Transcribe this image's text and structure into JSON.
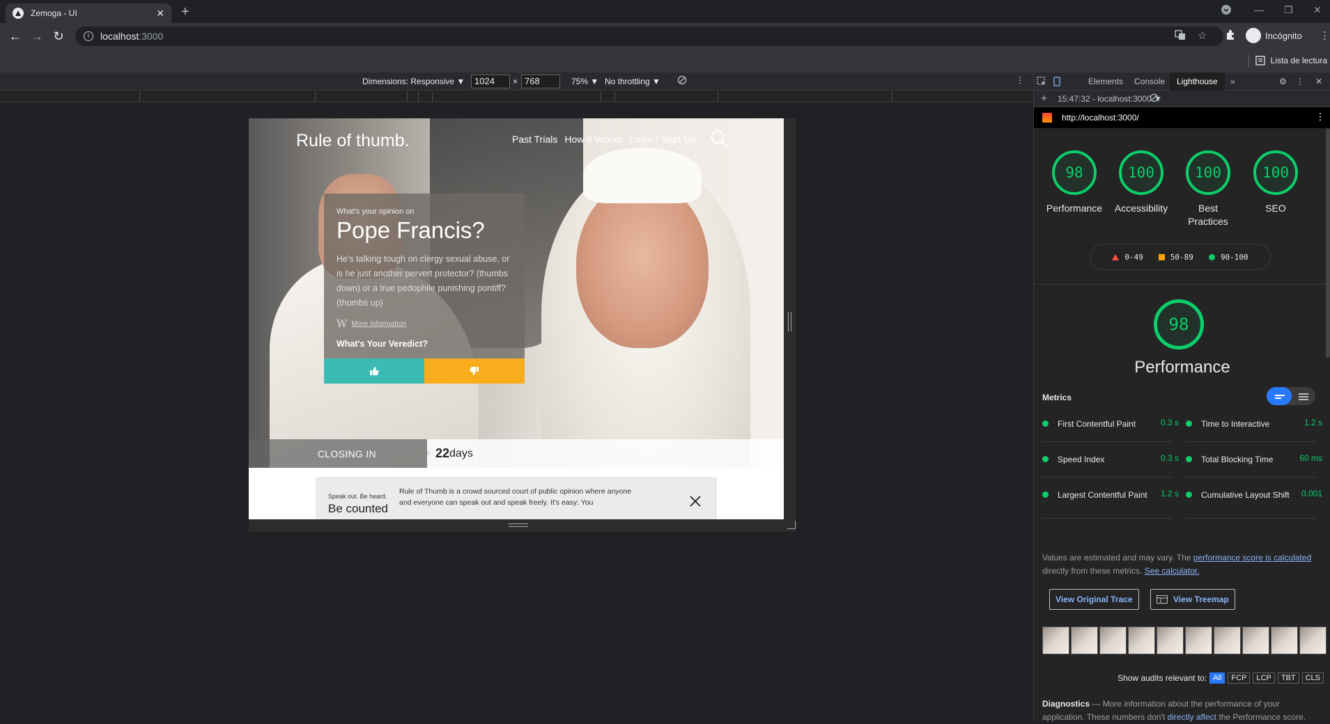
{
  "browser": {
    "tab_title": "Zemoga - UI",
    "url_host": "localhost",
    "url_port": ":3000",
    "profile_label": "Incógnito",
    "reading_list": "Lista de lectura"
  },
  "device_toolbar": {
    "dimensions": "Dimensions: Responsive ▼",
    "width": "1024",
    "separator": "×",
    "height": "768",
    "zoom": "75% ▼",
    "throttling": "No throttling ▼"
  },
  "site": {
    "brand": "Rule of thumb.",
    "nav": [
      "Past Trials",
      "How It Works",
      "Login / Sign Up"
    ],
    "card": {
      "pretitle": "What's your opinion on",
      "title": "Pope Francis?",
      "body": "He's talking tough on clergy sexual abuse, or is he just another pervert protector? (thumbs down) or a true pedophile punishing pontiff? (thumbs up)",
      "more": "More information",
      "veredict": "What's Your Veredict?"
    },
    "closing_label": "CLOSING IN",
    "days_number": "22",
    "days_label": "days",
    "notice": {
      "pre": "Speak out. Be heard.",
      "title": "Be counted",
      "body": "Rule of Thumb is a crowd sourced court of public opinion where anyone and everyone can speak out and speak freely. It's easy: You"
    }
  },
  "devtools": {
    "tabs": [
      "Elements",
      "Console",
      "Lighthouse"
    ],
    "active_tab": "Lighthouse",
    "report_select": "15:47:32 - localhost:3000 ▼",
    "report_url": "http://localhost:3000/",
    "scores": [
      {
        "value": "98",
        "label": "Performance"
      },
      {
        "value": "100",
        "label": "Accessibility"
      },
      {
        "value": "100",
        "label": "Best Practices"
      },
      {
        "value": "100",
        "label": "SEO"
      }
    ],
    "legend": [
      "0-49",
      "50-89",
      "90-100"
    ],
    "main_score": "98",
    "main_label": "Performance",
    "metrics_title": "Metrics",
    "metrics": [
      {
        "name": "First Contentful Paint",
        "value": "0.3 s"
      },
      {
        "name": "Time to Interactive",
        "value": "1.2 s"
      },
      {
        "name": "Speed Index",
        "value": "0.3 s"
      },
      {
        "name": "Total Blocking Time",
        "value": "60 ms"
      },
      {
        "name": "Largest Contentful Paint",
        "value": "1.2 s"
      },
      {
        "name": "Cumulative Layout Shift",
        "value": "0.001"
      }
    ],
    "estimate_text": "Values are estimated and may vary. The",
    "estimate_link1": "performance score is calculated",
    "estimate_text2": "directly from these metrics.",
    "estimate_link2": "See calculator.",
    "btn_trace": "View Original Trace",
    "btn_treemap": "View Treemap",
    "relevant_label": "Show audits relevant to:",
    "relevant_chips": [
      "All",
      "FCP",
      "LCP",
      "TBT",
      "CLS"
    ],
    "diag_title": "Diagnostics",
    "diag_text": "— More information about the performance of your application. These numbers don't",
    "diag_link": "directly affect",
    "diag_text2": "the Performance score."
  }
}
